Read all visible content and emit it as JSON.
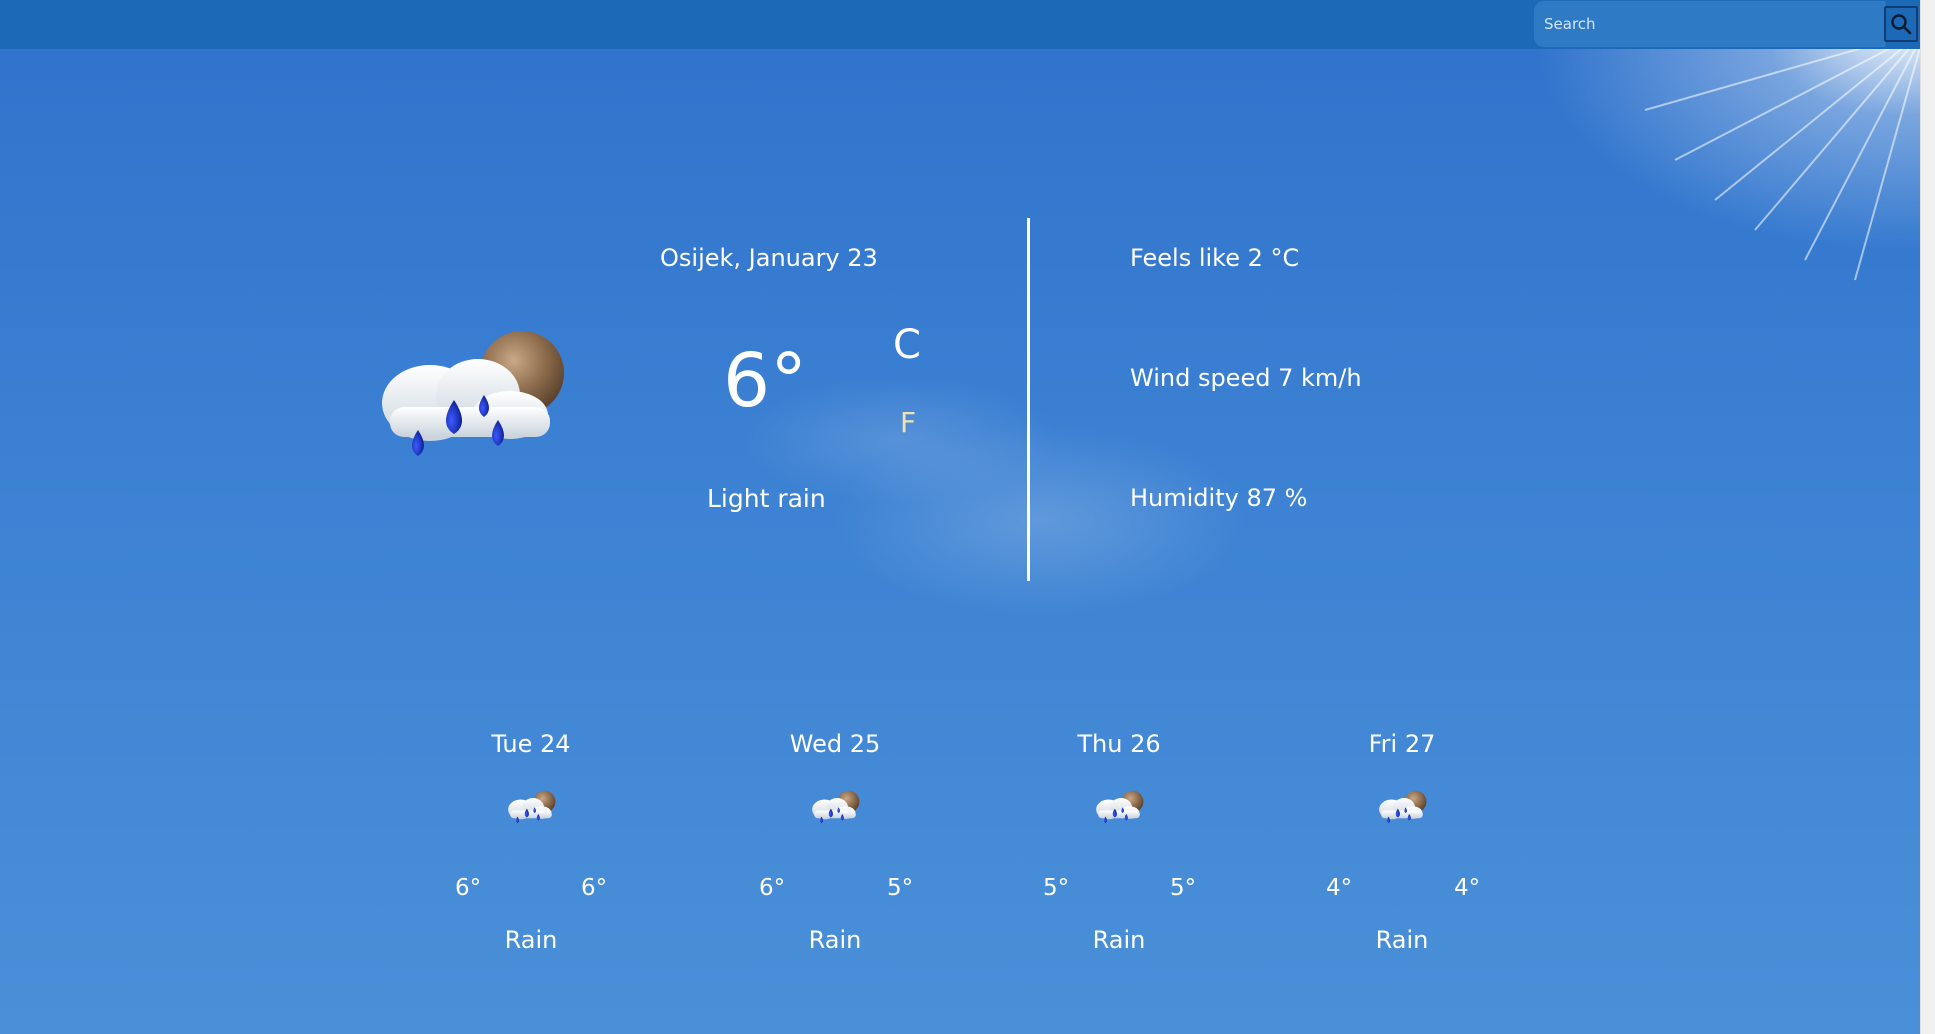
{
  "search": {
    "placeholder": "Search",
    "button_icon": "search-icon"
  },
  "current": {
    "location_date": "Osijek, January 23",
    "temperature": "6°",
    "unit_c": "C",
    "unit_f": "F",
    "description": "Light rain",
    "icon": "rain-cloud-moon-icon"
  },
  "details": {
    "feels_like": "Feels like 2 °C",
    "wind_speed": "Wind speed 7 km/h",
    "humidity": "Humidity 87 %"
  },
  "forecast": [
    {
      "day": "Tue 24",
      "high": "6°",
      "low": "6°",
      "description": "Rain",
      "icon": "rain-cloud-moon-icon"
    },
    {
      "day": "Wed 25",
      "high": "6°",
      "low": "5°",
      "description": "Rain",
      "icon": "rain-cloud-moon-icon"
    },
    {
      "day": "Thu 26",
      "high": "5°",
      "low": "5°",
      "description": "Rain",
      "icon": "rain-cloud-moon-icon"
    },
    {
      "day": "Fri 27",
      "high": "4°",
      "low": "4°",
      "description": "Rain",
      "icon": "rain-cloud-moon-icon"
    }
  ],
  "colors": {
    "topbar": "#1c69b8",
    "sky": "#3c81d3",
    "unit_f_accent": "#f2e2b0",
    "rain_drop": "#1a2fb0",
    "moon": "#8a6a4a"
  }
}
